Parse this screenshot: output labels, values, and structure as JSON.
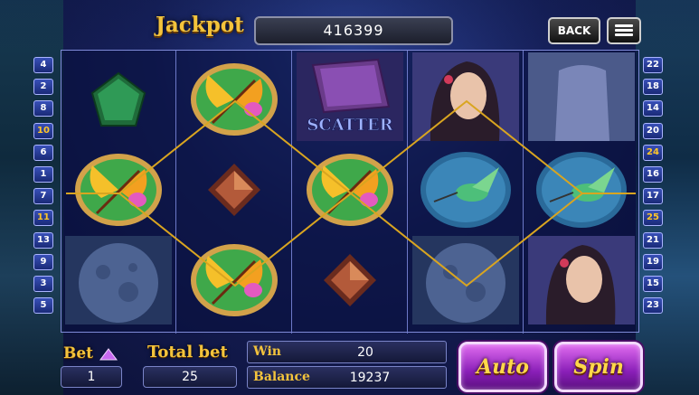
{
  "jackpot": {
    "label": "Jackpot",
    "value": "416399"
  },
  "top_buttons": {
    "back": "BACK",
    "menu_icon": "menu-icon"
  },
  "paylines_left": [
    "4",
    "2",
    "8",
    "10",
    "6",
    "1",
    "7",
    "11",
    "13",
    "9",
    "3",
    "5"
  ],
  "paylines_right": [
    "22",
    "18",
    "14",
    "20",
    "24",
    "16",
    "17",
    "25",
    "21",
    "19",
    "15",
    "23"
  ],
  "highlighted_lines": [
    "10",
    "11",
    "24",
    "25"
  ],
  "reels": [
    [
      "emerald-pentagon",
      "butterfly",
      "moon"
    ],
    [
      "butterfly",
      "topaz-diamond",
      "butterfly"
    ],
    [
      "scatter-book",
      "butterfly",
      "topaz-diamond"
    ],
    [
      "fairy-woman",
      "hummingbird",
      "moon"
    ],
    [
      "unicorn",
      "hummingbird",
      "fairy-woman"
    ]
  ],
  "scatter_label": "SCATTER",
  "bottom": {
    "bet_label": "Bet",
    "bet_value": "1",
    "total_bet_label": "Total bet",
    "total_bet_value": "25",
    "win_label": "Win",
    "win_value": "20",
    "balance_label": "Balance",
    "balance_value": "19237",
    "auto_label": "Auto",
    "spin_label": "Spin"
  },
  "colors": {
    "gold": "#f3c33c",
    "button_purple": "#8a1fb8",
    "win_line": "#d9a520"
  }
}
